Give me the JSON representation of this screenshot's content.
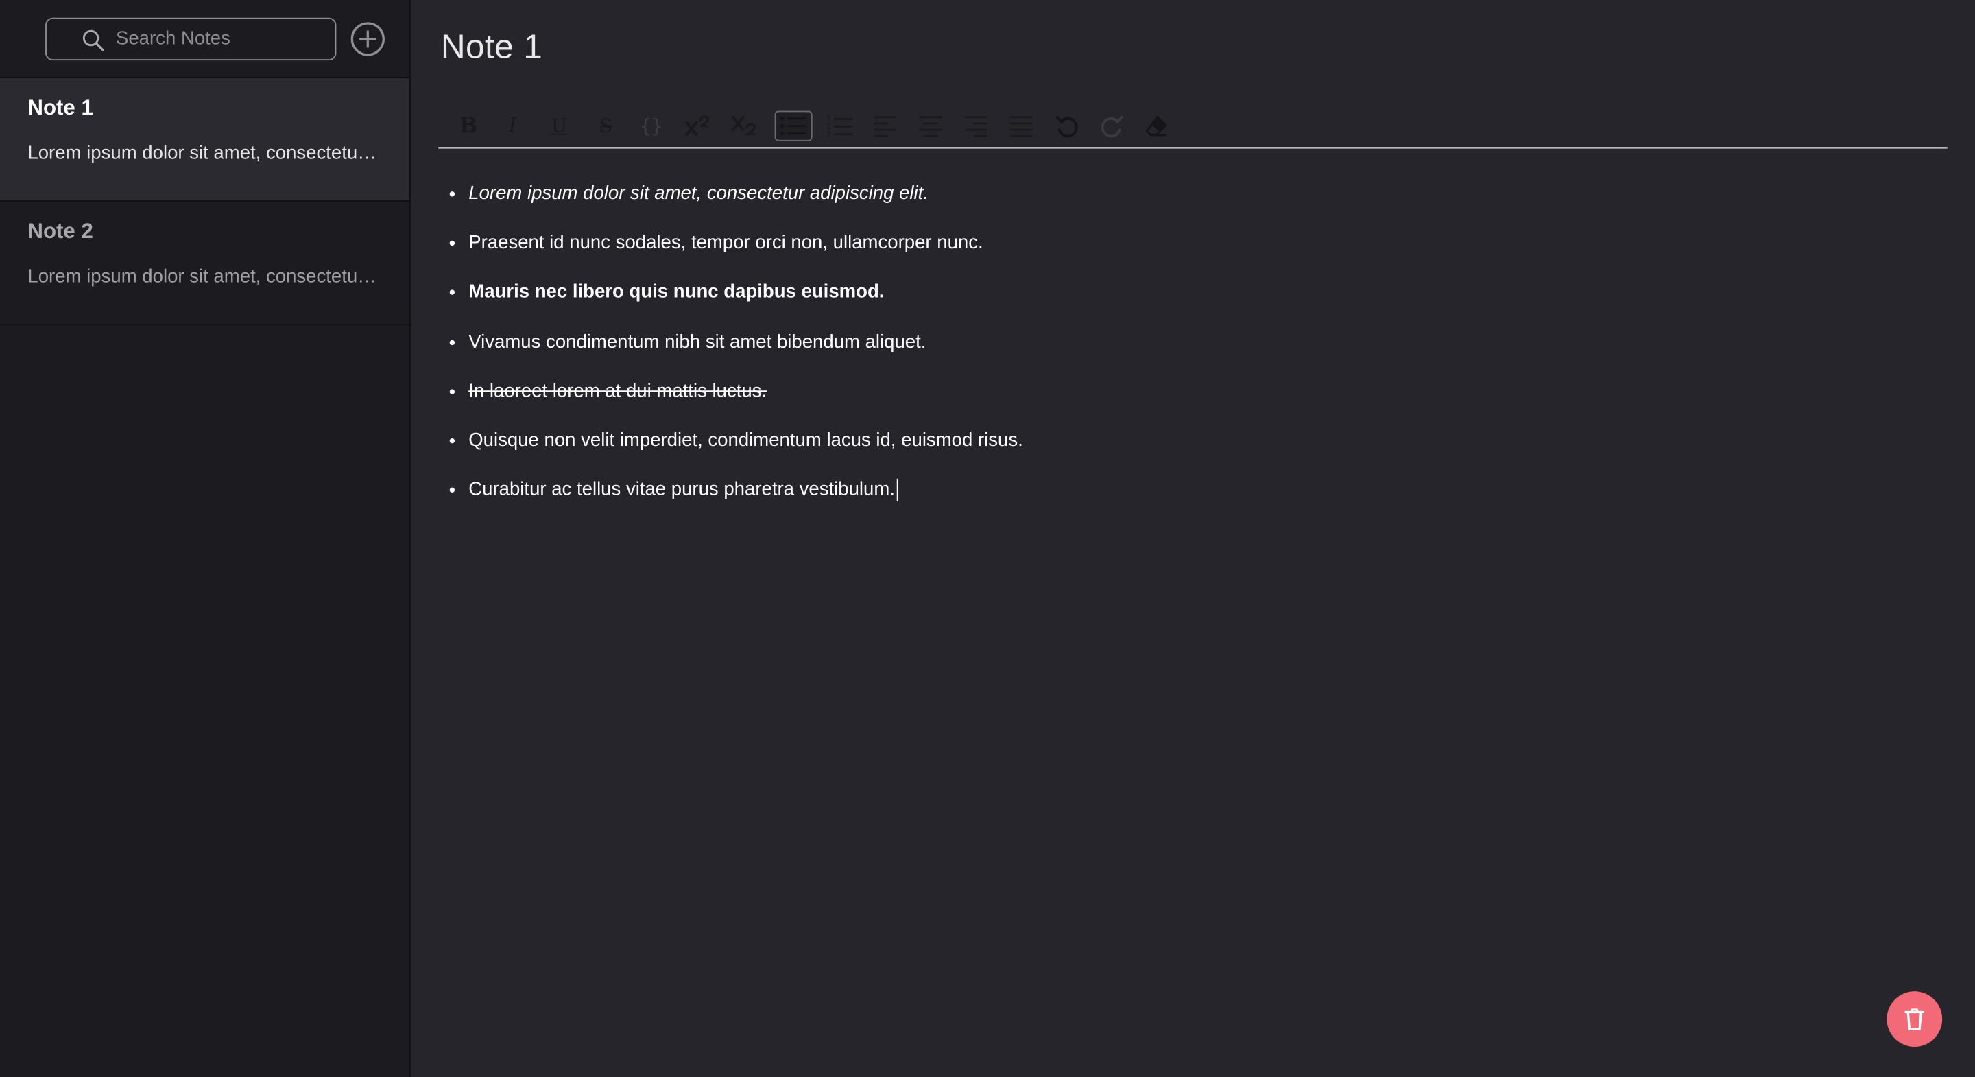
{
  "search": {
    "placeholder": "Search Notes",
    "value": ""
  },
  "sidebar": {
    "notes": [
      {
        "title": "Note 1",
        "preview": "Lorem ipsum dolor sit amet, consectetur adipiscing elit.",
        "active": true
      },
      {
        "title": "Note 2",
        "preview": "Lorem ipsum dolor sit amet, consectetur adipiscing elit.",
        "active": false
      }
    ]
  },
  "editor": {
    "title": "Note 1",
    "toolbar": {
      "bold": "B",
      "italic": "I",
      "underline": "U",
      "strikethrough": "S",
      "code": "{}",
      "active_tool": "bullet-list"
    },
    "items": [
      {
        "text": "Lorem ipsum dolor sit amet, consectetur adipiscing elit.",
        "style": "italic"
      },
      {
        "text": "Praesent id nunc sodales, tempor orci non, ullamcorper nunc.",
        "style": "normal"
      },
      {
        "text": "Mauris nec libero quis nunc dapibus euismod.",
        "style": "bold"
      },
      {
        "text": "Vivamus condimentum nibh sit amet bibendum aliquet.",
        "style": "normal"
      },
      {
        "text": "In laoreet lorem at dui mattis luctus.",
        "style": "strike"
      },
      {
        "text": "Quisque non velit imperdiet, condimentum lacus id, euismod risus.",
        "style": "normal"
      },
      {
        "text": "Curabitur ac tellus vitae purus pharetra vestibulum.",
        "style": "normal"
      }
    ]
  },
  "colors": {
    "background": "#25252b",
    "sidebar": "#1c1c20",
    "active_note": "#2a2a30",
    "delete_button": "#f26a78"
  },
  "icons": {
    "search": "search-icon",
    "add": "plus-circle-icon",
    "delete": "trash-icon"
  }
}
